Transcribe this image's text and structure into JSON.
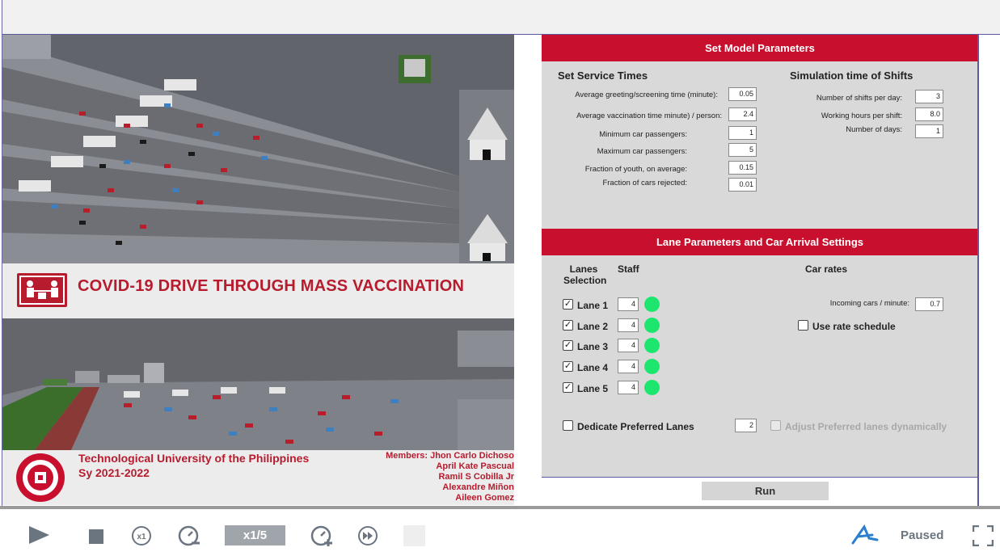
{
  "model": {
    "title": "COVID-19 DRIVE THROUGH MASS VACCINATION",
    "university": "Technological University of the Philippines",
    "school_year": "Sy 2021-2022",
    "members": [
      "Members: Jhon Carlo Dichoso",
      "April Kate Pascual",
      "Ramil S Cobilla Jr",
      "Alexandre Miñon",
      "Aileen Gomez"
    ]
  },
  "model_params": {
    "header": "Set Model Parameters",
    "service_times": {
      "title": "Set Service Times",
      "fields": [
        {
          "label": "Average greeting/screening time (minute):",
          "value": "0.05"
        },
        {
          "label": "Average vaccination time minute) / person:",
          "value": "2.4"
        },
        {
          "label": "Minimum car passengers:",
          "value": "1"
        },
        {
          "label": "Maximum car passengers:",
          "value": "5"
        },
        {
          "label": "Fraction of youth, on average:",
          "value": "0.15"
        },
        {
          "label": "Fraction of cars rejected:",
          "value": "0.01"
        }
      ]
    },
    "shifts": {
      "title": "Simulation time of Shifts",
      "fields": [
        {
          "label": "Number of shifts per day:",
          "value": "3"
        },
        {
          "label": "Working hours per shift:",
          "value": "8.0"
        },
        {
          "label": "Number of days:",
          "value": "1"
        }
      ]
    }
  },
  "lane_params": {
    "header": "Lane Parameters and Car Arrival Settings",
    "col_lanes_1": "Lanes",
    "col_lanes_2": "Selection",
    "col_staff": "Staff",
    "col_rates": "Car rates",
    "lanes": [
      {
        "label": "Lane 1",
        "checked": "✓",
        "staff": "4"
      },
      {
        "label": "Lane 2",
        "checked": "✓",
        "staff": "4"
      },
      {
        "label": "Lane 3",
        "checked": "✓",
        "staff": "4"
      },
      {
        "label": "Lane 4",
        "checked": "✓",
        "staff": "4"
      },
      {
        "label": "Lane 5",
        "checked": "✓",
        "staff": "4"
      }
    ],
    "incoming_label": "Incoming cars / minute:",
    "incoming_value": "0.7",
    "rate_schedule_label": "Use rate schedule",
    "dedicate_label": "Dedicate Preferred Lanes",
    "dedicate_value": "2",
    "adjust_label": "Adjust Preferred lanes dynamically",
    "status_color": "#1de66f"
  },
  "run_label": "Run",
  "controls": {
    "speed": "x1/5",
    "status": "Paused",
    "icons": [
      "play-icon",
      "stop-icon",
      "speed-reset-icon",
      "slow-down-icon",
      "speed-up-icon",
      "fast-forward-icon",
      "step-icon",
      "anylogic-logo-icon",
      "fullscreen-icon"
    ]
  },
  "colors": {
    "accent": "#c8102e",
    "panel": "#d9d9d9",
    "lane_dot": "#1de66f"
  }
}
